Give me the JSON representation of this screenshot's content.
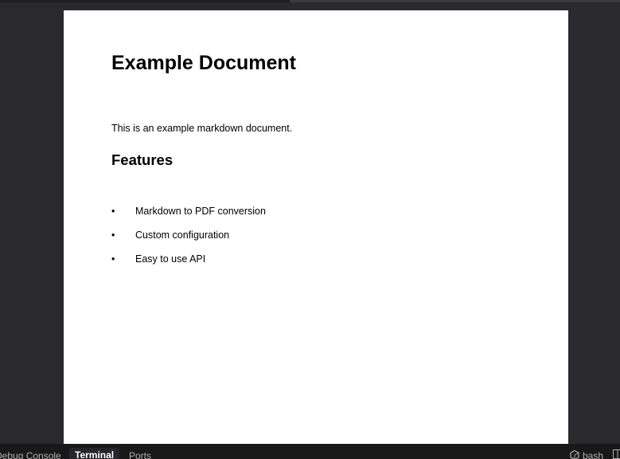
{
  "document": {
    "title": "Example Document",
    "paragraph": "This is an example markdown document.",
    "section_heading": "Features",
    "bullet_glyph": "•",
    "features": [
      "Markdown to PDF conversion",
      "Custom configuration",
      "Easy to use API"
    ]
  },
  "panel": {
    "tabs": [
      {
        "label": "Debug Console"
      },
      {
        "label": "Terminal"
      },
      {
        "label": "Ports"
      }
    ],
    "active_tab": "Terminal",
    "terminal_name": "bash",
    "terminal_icon": "terminal-shell-icon",
    "split_icon": "split-terminal-icon"
  },
  "colors": {
    "viewer_background": "#2a2a2e",
    "page_background": "#ffffff",
    "panel_background": "#181818",
    "active_tab_text": "#ffffff",
    "inactive_tab_text": "#b0b0b0"
  }
}
